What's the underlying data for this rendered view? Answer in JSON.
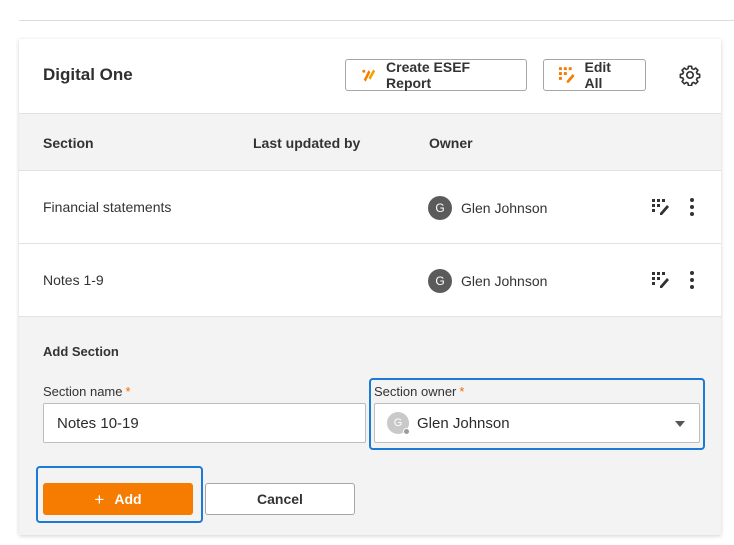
{
  "card": {
    "title": "Digital One",
    "buttons": {
      "create_esef_label": "Create ESEF Report",
      "edit_all_label": "Edit All"
    }
  },
  "table": {
    "headers": {
      "section": "Section",
      "last_updated_by": "Last updated by",
      "owner": "Owner"
    },
    "rows": [
      {
        "section": "Financial statements",
        "last_updated_by": "",
        "owner_initial": "G",
        "owner": "Glen Johnson"
      },
      {
        "section": "Notes 1-9",
        "last_updated_by": "",
        "owner_initial": "G",
        "owner": "Glen Johnson"
      }
    ]
  },
  "add_section": {
    "title": "Add Section",
    "name_label": "Section name",
    "owner_label": "Section owner",
    "required_mark": "*",
    "name_value": "Notes 10-19",
    "owner_initial": "G",
    "owner_value": "Glen Johnson",
    "add_label": "Add",
    "add_icon": "+",
    "cancel_label": "Cancel"
  },
  "colors": {
    "accent_orange": "#f57c00",
    "focus_blue": "#1b7ad6"
  },
  "icons": [
    "esef-report-icon",
    "edit-grid-icon",
    "gear-icon",
    "more-vertical-icon",
    "chevron-down-icon",
    "plus-icon"
  ]
}
